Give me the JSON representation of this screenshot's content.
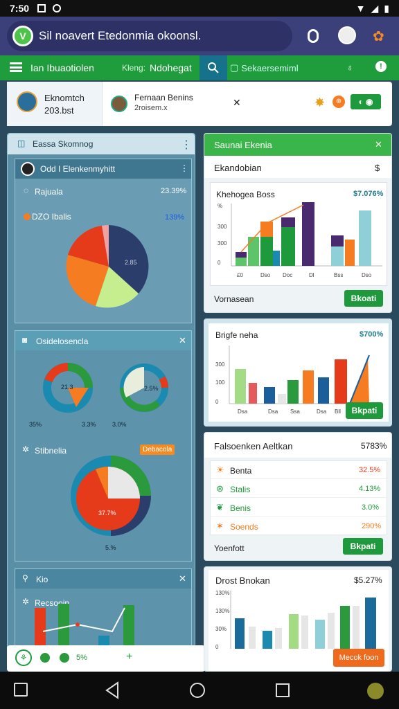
{
  "status": {
    "time": "7:50"
  },
  "app": {
    "title": "Sil noavert Etedonmia okoonsl."
  },
  "nav": {
    "left_label": "Ian Ibuaotiolen",
    "mid_label": "Kleng:",
    "mid_value": "Ndohegat",
    "search_placeholder": "Sekaersemiml"
  },
  "user_strip": {
    "user1_name": "Eknomtch",
    "user1_sub": "203.bst",
    "user2_name": "Fernaan Benins",
    "user2_sub": "2roisem.x"
  },
  "left": {
    "header": "Eassa Skomnog",
    "widget1": {
      "title": "Odd I Elenkenmyhitt",
      "row1_label": "Rajuala",
      "row1_value": "23.39%",
      "row2_label": "DZO Ibalis",
      "row2_value": "139%",
      "pie_label": "2.85"
    },
    "widget2": {
      "title": "Osidelosencla",
      "d1_inner": "21.3",
      "d1_left": "35%",
      "d1_right": "3.3%",
      "d2_inner": "2.5%",
      "d2_left": "3.0%"
    },
    "widget3": {
      "title": "Stibnelia",
      "badge": "Debacola",
      "pie_label": "37.7%",
      "bottom": "5.%"
    },
    "widget4": {
      "title": "Kio",
      "sub": "Recsooin"
    },
    "bottom": {
      "count": "5%"
    }
  },
  "right": {
    "header": "Saunai Ekenia",
    "card1": {
      "label": "Ekandobian",
      "value": "$",
      "inner_title": "Khehogea Boss",
      "inner_value": "$7.076%",
      "footer": "Vornasean",
      "button": "Bkoati"
    },
    "card2": {
      "inner_title": "Brigfe neha",
      "inner_value": "$700%",
      "button": "Bkpati"
    },
    "card3": {
      "title": "Falsoenken Aeltkan",
      "value": "5783%",
      "rows": [
        {
          "label": "Benta",
          "value": "32.5%"
        },
        {
          "label": "Stalis",
          "value": "4.13%"
        },
        {
          "label": "Benis",
          "value": "3.0%"
        },
        {
          "label": "Soends",
          "value": "290%"
        }
      ],
      "footer": "Yoenfott",
      "button": "Bkpati"
    },
    "card4": {
      "title": "Drost Bnokan",
      "value": "$5.27%",
      "button": "Mecok foon"
    }
  },
  "colors": {
    "green": "#1e9a3c",
    "navy": "#2b3d6b",
    "orange": "#f57c20",
    "red": "#e53b1b",
    "teal": "#1b8ab0"
  }
}
